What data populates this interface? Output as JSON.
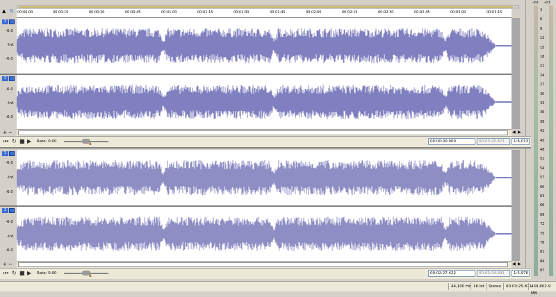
{
  "ruler": {
    "ticks": [
      "00:00:00",
      "00:00:15",
      "00:00:30",
      "00:00:45",
      "00:01:00",
      "00:01:15",
      "00:01:30",
      "00:01:45",
      "00:02:00",
      "00:02:15",
      "00:02:30",
      "00:02:45",
      "00:03:00",
      "00:03:15"
    ]
  },
  "channel_scale": {
    "top": "-6.0",
    "mid": "-Inf.",
    "bottom": "-6.0"
  },
  "channels": {
    "ch1": "1",
    "ch2": "2"
  },
  "transport_top": {
    "rate_label": "Rate: 0.00",
    "selection_start": "00:00:00.000",
    "selection_end": "00:03:25.871",
    "zoom": "1:6,013"
  },
  "transport_bottom": {
    "rate_label": "Rate: 0.00",
    "selection_start": "00:02:27.422",
    "selection_end": "00:03:24.931",
    "zoom": "1:5,970"
  },
  "meter": {
    "header_left": "-Inf.",
    "header_right": "-Inf.",
    "ticks": [
      "3",
      "6",
      "9",
      "12",
      "15",
      "18",
      "21",
      "24",
      "27",
      "30",
      "33",
      "36",
      "39",
      "42",
      "45",
      "48",
      "51",
      "54",
      "57",
      "60",
      "63",
      "66",
      "69",
      "72",
      "75",
      "78",
      "81",
      "84",
      "87"
    ]
  },
  "status": {
    "sample_rate": "44,100 Hz",
    "bit_depth": "16 bit",
    "channels": "Stereo",
    "length": "00:03:25.871",
    "disk_space": "439,802.9 MB"
  },
  "colors": {
    "waveform": "#000080",
    "selection": "#1c1c8a",
    "accent": "#3b6fd6"
  },
  "icons": [
    "lock-icon",
    "marker-icon",
    "rewind-icon",
    "stop-icon",
    "play-icon",
    "loop-icon",
    "rate-slider-icon",
    "scroll-left-icon",
    "scroll-right-icon",
    "zoom-in-icon",
    "zoom-out-icon"
  ]
}
